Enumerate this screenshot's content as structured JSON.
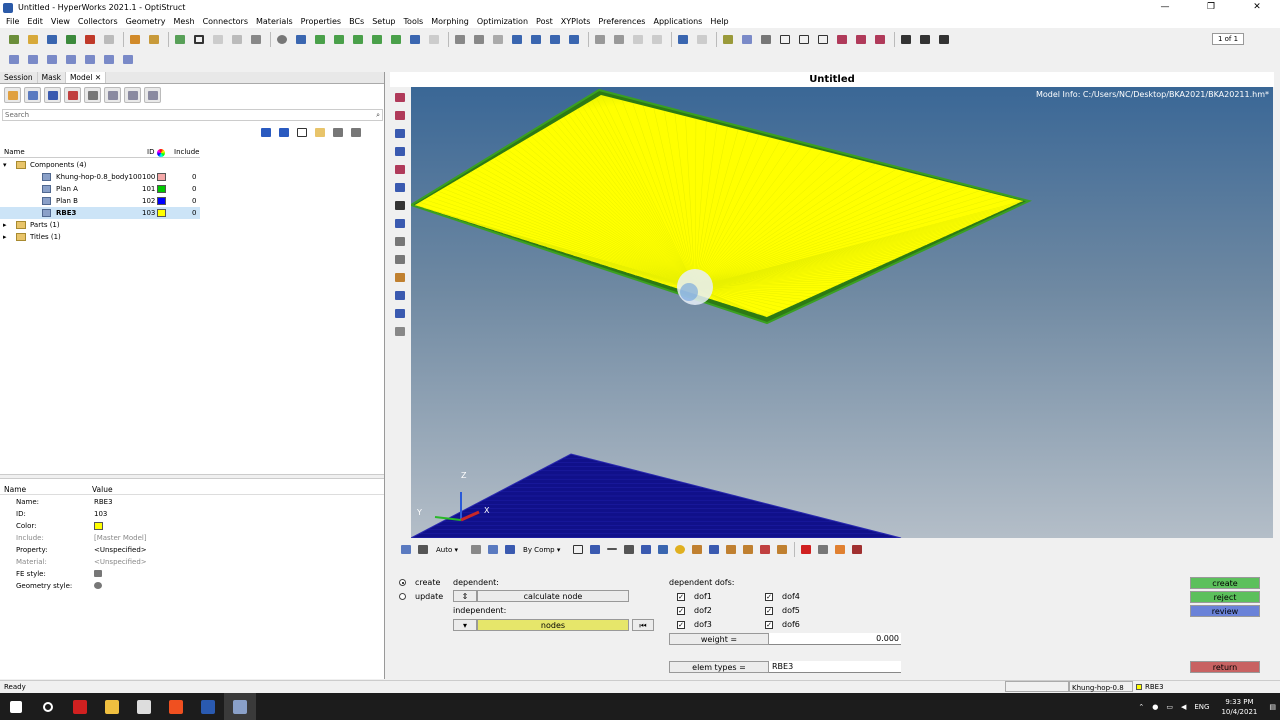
{
  "window": {
    "title": "Untitled - HyperWorks 2021.1 - OptiStruct",
    "minimize": "—",
    "maximize": "❐",
    "close": "✕"
  },
  "menu": [
    "File",
    "Edit",
    "View",
    "Collectors",
    "Geometry",
    "Mesh",
    "Connectors",
    "Materials",
    "Properties",
    "BCs",
    "Setup",
    "Tools",
    "Morphing",
    "Optimization",
    "Post",
    "XYPlots",
    "Preferences",
    "Applications",
    "Help"
  ],
  "pager": "1 of 1",
  "browser": {
    "tabs": [
      "Session",
      "Mask",
      "Model"
    ],
    "tab_close": "✕",
    "search_placeholder": "Search",
    "columns": {
      "name": "Name",
      "id": "ID",
      "include": "Include"
    },
    "tree": [
      {
        "label": "Components (4)",
        "id": "",
        "include": "",
        "color": ""
      },
      {
        "label": "Khung-hop-0.8_body100",
        "id": "100",
        "include": "0",
        "color": "#f4a8a8"
      },
      {
        "label": "Plan A",
        "id": "101",
        "include": "0",
        "color": "#00c800"
      },
      {
        "label": "Plan B",
        "id": "102",
        "include": "0",
        "color": "#0000ff"
      },
      {
        "label": "RBE3",
        "id": "103",
        "include": "0",
        "color": "#ffff00"
      },
      {
        "label": "Parts (1)",
        "id": "",
        "include": "",
        "color": ""
      },
      {
        "label": "Titles (1)",
        "id": "",
        "include": "",
        "color": ""
      }
    ]
  },
  "properties": {
    "header_name": "Name",
    "header_value": "Value",
    "rows": [
      {
        "key": "Name:",
        "value": "RBE3"
      },
      {
        "key": "ID:",
        "value": "103"
      },
      {
        "key": "Color:",
        "value": ""
      },
      {
        "key": "Include:",
        "value": "[Master Model]"
      },
      {
        "key": "Property:",
        "value": "<Unspecified>"
      },
      {
        "key": "Material:",
        "value": "<Unspecified>"
      },
      {
        "key": "FE style:",
        "value": ""
      },
      {
        "key": "Geometry style:",
        "value": ""
      }
    ],
    "color_value": "#ffff00"
  },
  "viewport": {
    "title": "Untitled",
    "model_info": "Model Info: C:/Users/NC/Desktop/BKA2021/BKA20211.hm*",
    "axis_z": "Z",
    "axis_x": "X",
    "axis_y": "Y",
    "mode": "Auto",
    "color_by": "By Comp"
  },
  "panel": {
    "create": "create",
    "update": "update",
    "dependent": "dependent:",
    "calculate_node": "calculate node",
    "independent": "independent:",
    "nodes": "nodes",
    "dependent_dofs": "dependent dofs:",
    "dofs": [
      "dof1",
      "dof2",
      "dof3",
      "dof4",
      "dof5",
      "dof6"
    ],
    "weight_label": "weight =",
    "weight_value": "0.000",
    "elem_types_label": "elem types =",
    "elem_types_value": "RBE3",
    "btn_create": "create",
    "btn_reject": "reject",
    "btn_review": "review",
    "btn_return": "return"
  },
  "status": {
    "text": "Ready",
    "component": "Khung-hop-0.8",
    "current": "RBE3"
  },
  "tray": {
    "lang": "ENG",
    "time": "9:33 PM",
    "date": "10/4/2021"
  }
}
